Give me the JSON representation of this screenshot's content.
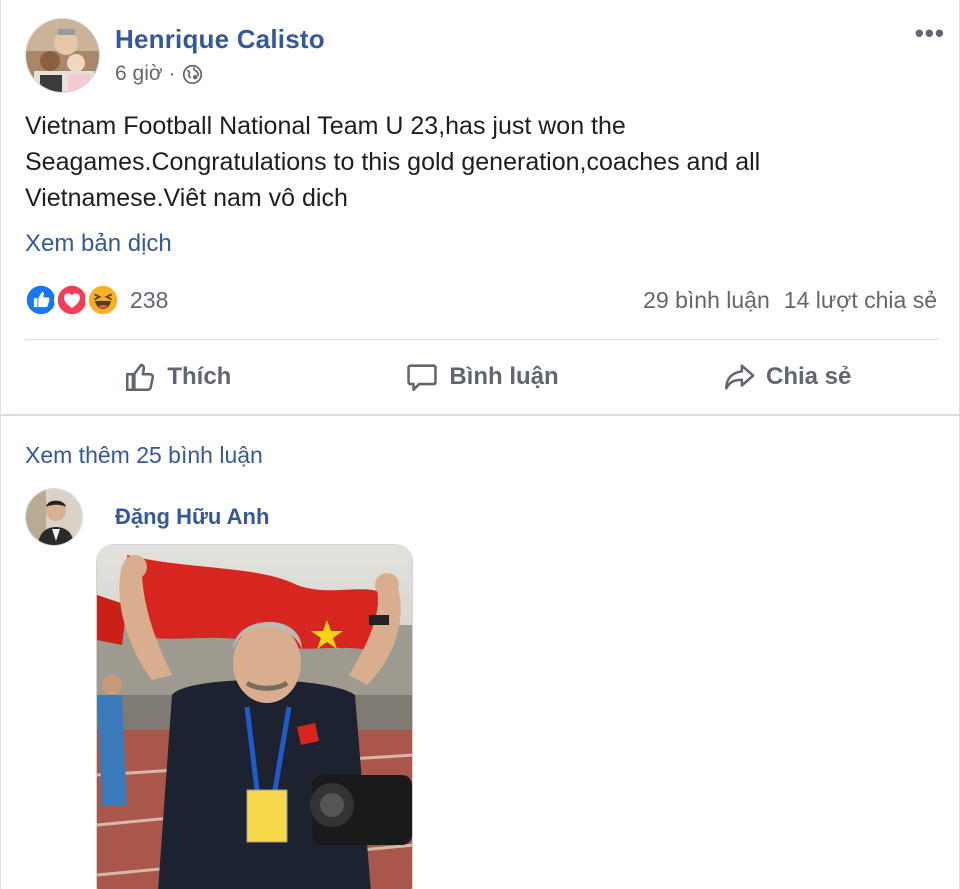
{
  "post": {
    "author": "Henrique Calisto",
    "time": "6 giờ",
    "separator": "·",
    "privacy_icon": "globe-icon",
    "more_icon": "more-horizontal-icon",
    "more_label": "•••",
    "text": "Vietnam Football National Team U 23,has just won the\nSeagames.Congratulations to this gold generation,coaches and all\nVietnamese.Viêt nam vô dich",
    "translate_link": "Xem bản dịch"
  },
  "reactions": {
    "icons": [
      "like-reaction-icon",
      "love-reaction-icon",
      "haha-reaction-icon"
    ],
    "count": "238",
    "comments": "29 bình luận",
    "shares": "14 lượt chia sẻ"
  },
  "actions": {
    "like": "Thích",
    "comment": "Bình luận",
    "share": "Chia sẻ"
  },
  "comments": {
    "more_link": "Xem thêm 25 bình luận",
    "items": [
      {
        "author": "Đặng Hữu Anh",
        "attachment": "photo"
      }
    ]
  },
  "colors": {
    "link": "#365899",
    "secondary_text": "#606770",
    "like_blue": "#1877f2",
    "love_red": "#f33e58",
    "haha_yellow": "#f7b125",
    "divider": "#dadde1"
  }
}
